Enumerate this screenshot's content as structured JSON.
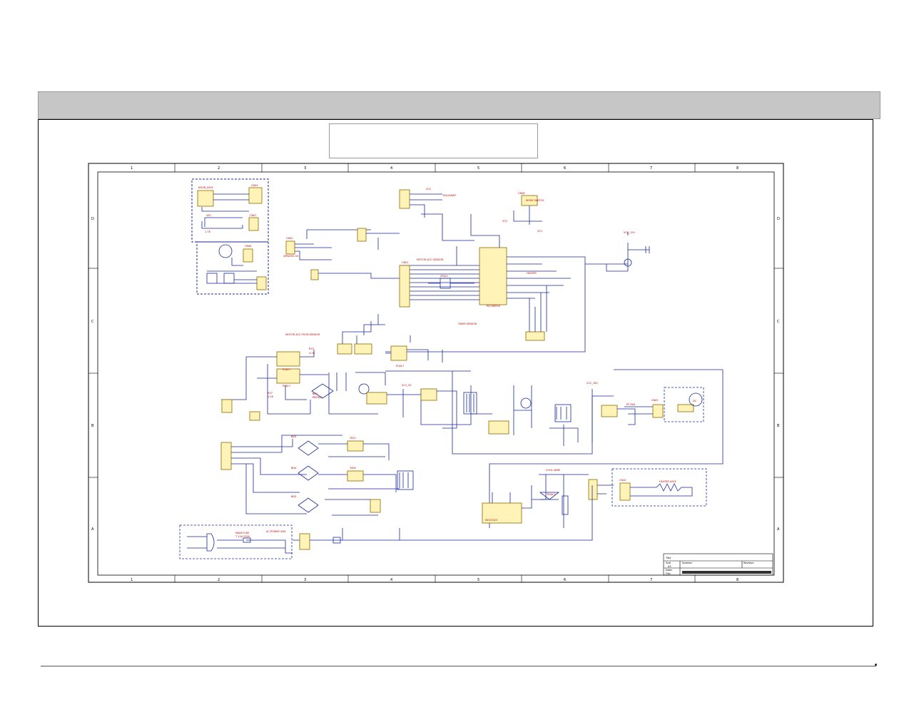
{
  "sheet": {
    "columns": [
      "1",
      "2",
      "3",
      "4",
      "5",
      "6",
      "7",
      "8"
    ],
    "rows": [
      "D",
      "C",
      "B",
      "A"
    ]
  },
  "labels": {
    "cn09": "CN09",
    "cn09_sub": "SMW200-04",
    "knob_assy": "KNOB_ASSY",
    "vr1": "VR1",
    "vr1_val": "1.7K",
    "cn07": "CN07",
    "cn08": "CN08",
    "cn02": "CN02",
    "cn02_sub": "SMW200-04",
    "vcc1": "VCC",
    "vcc2": "VCC",
    "vcc3": "VCC",
    "vcc_12v": "VCC_12V",
    "vcc_16v": "VCC_16V",
    "vcc_5v": "VCC_5V",
    "d11": "D11",
    "d11_sub": "1N4148WT",
    "cn06": "CN06",
    "cn06_sub": "SMW200-04",
    "mode_switch": "MODE SWITCH",
    "motor_ac": "MOTOR ACC SENSOR",
    "cn01": "CN01",
    "u5_part": "PIC16F876",
    "heater": "HEATER",
    "xtal1": "XTAL1",
    "timer_sensor": "TIMER SENSOR",
    "r51": "R51",
    "q4": "Q4",
    "cn03": "CN03",
    "cn04": "CN04",
    "pc817_1": "PC817",
    "pc817_2": "PC817",
    "pc817_3": "PC817",
    "bd1": "BD1",
    "bd1_sub": "PB5500",
    "r33": "R33",
    "r33_val": "4.7K",
    "r37": "R37",
    "r37_val": "2.2K",
    "motor_acc_sensor2": "MOTOR ACC FROM SENSOR",
    "dc_label": "DC",
    "pf_fan": "PF FAN",
    "cn05": "CN05",
    "cn05_sub": "SMW200-02",
    "bd3": "BD3",
    "bd4": "BD4",
    "bd5": "BD5",
    "bd2": "BD2",
    "u3_part": "7812",
    "u4_part": "7805",
    "t_sensor": "THERMISTOR",
    "cn10": "CN10",
    "heater_assy": "HEATER ASSY",
    "cool_wire": "COOL WIRE",
    "triac1": "TRIAC1",
    "moc3023": "MOC3023",
    "main_fuse": "MAIN FUSE",
    "fuse_val": "T 10A 250V",
    "ac_power": "AC POWER SW1",
    "cn_bottom": "CN5",
    "title_label": "Title",
    "size_label": "Size",
    "size_val": "A3",
    "number_label": "Number",
    "revision_label": "Revision",
    "date_label": "Date:",
    "file_label": "File:"
  }
}
